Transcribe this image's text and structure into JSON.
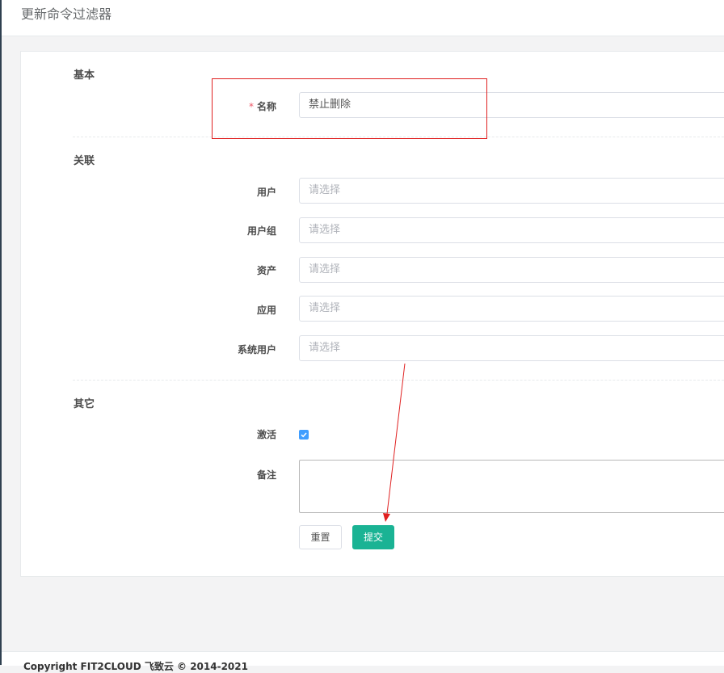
{
  "page": {
    "title": "更新命令过滤器"
  },
  "sections": {
    "basic": "基本",
    "relations": "关联",
    "other": "其它"
  },
  "fields": {
    "name": {
      "label": "名称",
      "required_mark": "*",
      "value": "禁止删除"
    },
    "users": {
      "label": "用户",
      "placeholder": "请选择"
    },
    "user_groups": {
      "label": "用户组",
      "placeholder": "请选择"
    },
    "assets": {
      "label": "资产",
      "placeholder": "请选择"
    },
    "applications": {
      "label": "应用",
      "placeholder": "请选择"
    },
    "system_users": {
      "label": "系统用户",
      "placeholder": "请选择"
    },
    "active": {
      "label": "激活",
      "checked": true
    },
    "comment": {
      "label": "备注",
      "value": ""
    }
  },
  "buttons": {
    "reset": "重置",
    "submit": "提交"
  },
  "footer": {
    "copyright": "Copyright FIT2CLOUD 飞致云 © 2014-2021"
  },
  "colors": {
    "accent": "#1ab394",
    "checkbox": "#409eff",
    "annotation": "#e02020"
  },
  "icons": {
    "checkbox": "check-icon"
  }
}
